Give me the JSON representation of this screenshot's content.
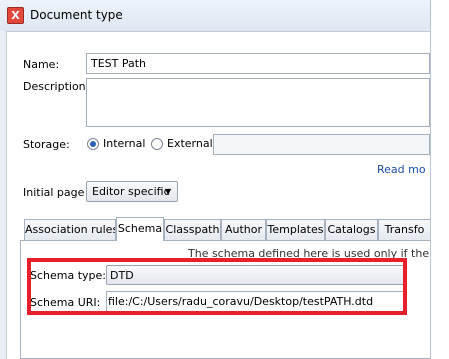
{
  "window": {
    "title": "Document type",
    "app_icon": "X"
  },
  "form": {
    "name_label": "Name:",
    "name_value": "TEST Path",
    "description_label": "Description:",
    "description_value": "",
    "storage_label": "Storage:",
    "storage_internal": "Internal",
    "storage_external": "External",
    "storage_selected": "Internal",
    "storage_external_value": "",
    "read_more": "Read mo",
    "initial_page_label": "Initial page",
    "initial_page_value": "Editor specific"
  },
  "tabs": [
    {
      "label": "Association rules",
      "active": false
    },
    {
      "label": "Schema",
      "active": true
    },
    {
      "label": "Classpath",
      "active": false
    },
    {
      "label": "Author",
      "active": false
    },
    {
      "label": "Templates",
      "active": false
    },
    {
      "label": "Catalogs",
      "active": false
    },
    {
      "label": "Transfo",
      "active": false
    }
  ],
  "schema": {
    "info_text": "The schema defined here is used only if there is n",
    "type_label": "Schema type:",
    "type_value": "DTD",
    "uri_label": "Schema URI:",
    "uri_value": "file:/C:/Users/radu_coravu/Desktop/testPATH.dtd"
  },
  "colors": {
    "highlight": "#e8202c",
    "link": "#1d4fa6",
    "radio_selected": "#2d5fb3"
  }
}
